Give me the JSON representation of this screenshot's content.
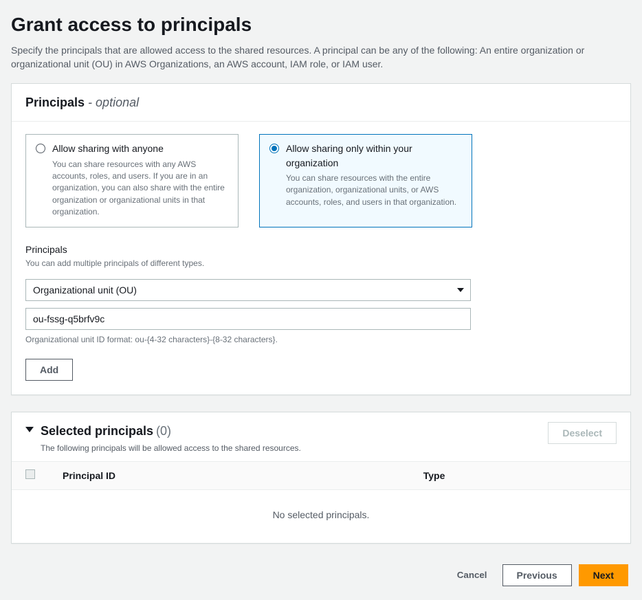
{
  "page": {
    "title": "Grant access to principals",
    "description": "Specify the principals that are allowed access to the shared resources. A principal can be any of the following: An entire organization or organizational unit (OU) in AWS Organizations, an AWS account, IAM role, or IAM user."
  },
  "principalsPanel": {
    "title": "Principals",
    "dash": " - ",
    "optional": "optional",
    "sharingOptions": {
      "anyone": {
        "label": "Allow sharing with anyone",
        "desc": "You can share resources with any AWS accounts, roles, and users. If you are in an organization, you can also share with the entire organization or organizational units in that organization.",
        "selected": false
      },
      "orgOnly": {
        "label": "Allow sharing only within your organization",
        "desc": "You can share resources with the entire organization, organizational units, or AWS accounts, roles, and users in that organization.",
        "selected": true
      }
    },
    "principalsField": {
      "label": "Principals",
      "help": "You can add multiple principals of different types.",
      "typeSelected": "Organizational unit (OU)",
      "idValue": "ou-fssg-q5brfv9c",
      "formatHint": "Organizational unit ID format: ou-{4-32 characters}-{8-32 characters}."
    },
    "addButton": "Add"
  },
  "selectedPanel": {
    "title": "Selected principals",
    "count": "(0)",
    "subtitle": "The following principals will be allowed access to the shared resources.",
    "deselectLabel": "Deselect",
    "columns": {
      "id": "Principal ID",
      "type": "Type"
    },
    "emptyText": "No selected principals."
  },
  "footer": {
    "cancel": "Cancel",
    "previous": "Previous",
    "next": "Next"
  }
}
